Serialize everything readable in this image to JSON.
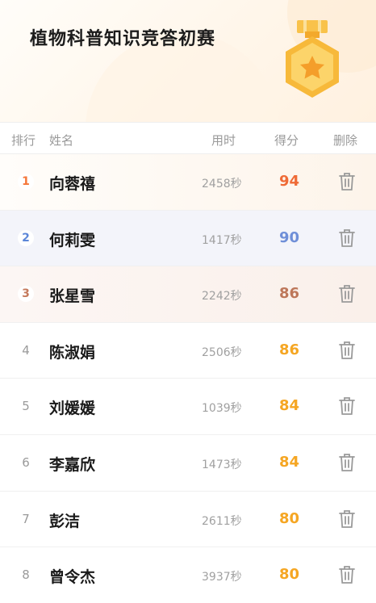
{
  "header": {
    "title": "植物科普知识竞答初赛"
  },
  "columns": {
    "rank": "排行",
    "name": "姓名",
    "time": "用时",
    "score": "得分",
    "delete": "删除"
  },
  "colors": {
    "gold": "#ef6a36",
    "silver": "#6f8fd8",
    "bronze": "#bd775a",
    "normal": "#f5a623"
  },
  "rows": [
    {
      "rank": "1",
      "name": "向蓉禧",
      "time": "2458秒",
      "score": "94"
    },
    {
      "rank": "2",
      "name": "何莉雯",
      "time": "1417秒",
      "score": "90"
    },
    {
      "rank": "3",
      "name": "张星雪",
      "time": "2242秒",
      "score": "86"
    },
    {
      "rank": "4",
      "name": "陈淑娟",
      "time": "2506秒",
      "score": "86"
    },
    {
      "rank": "5",
      "name": "刘媛媛",
      "time": "1039秒",
      "score": "84"
    },
    {
      "rank": "6",
      "name": "李嘉欣",
      "time": "1473秒",
      "score": "84"
    },
    {
      "rank": "7",
      "name": "彭洁",
      "time": "2611秒",
      "score": "80"
    },
    {
      "rank": "8",
      "name": "曾令杰",
      "time": "3937秒",
      "score": "80"
    }
  ]
}
